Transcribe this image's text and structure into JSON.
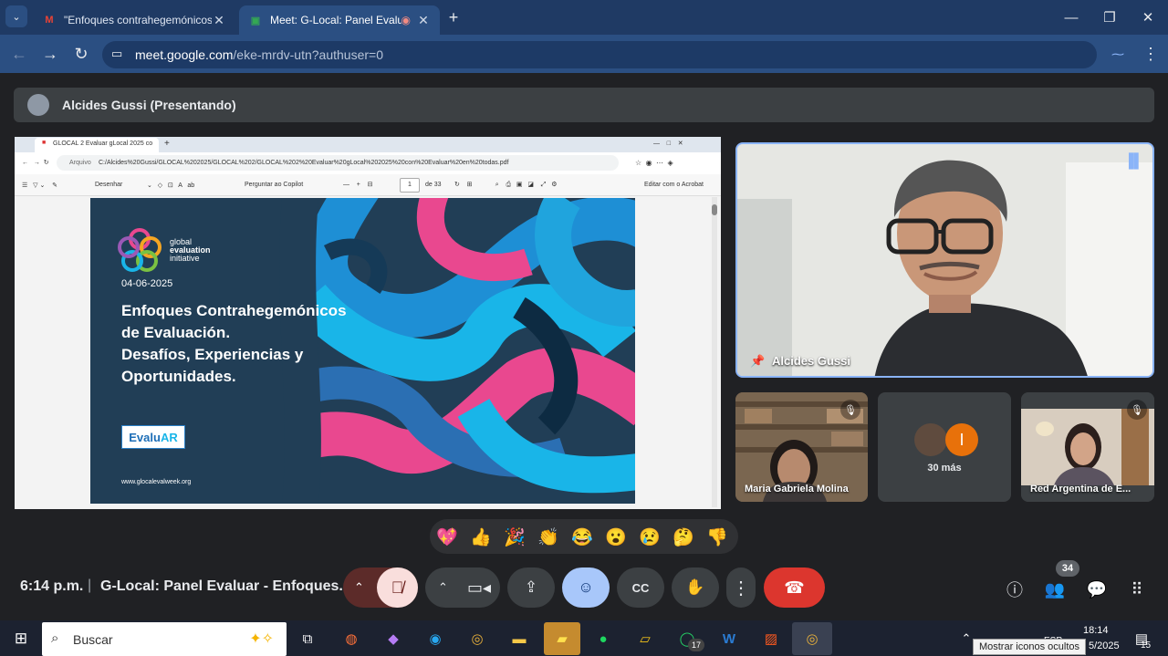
{
  "browser": {
    "tabs": [
      {
        "title": "\"Enfoques contrahegemónicos",
        "favicon": "gmail-icon"
      },
      {
        "title": "Meet: G-Local: Panel Evaluar",
        "favicon": "meet-icon"
      }
    ],
    "url_host": "meet.google.com",
    "url_path": "/eke-mrdv-utn?authuser=0"
  },
  "meet": {
    "presenter_banner": "Alcides Gussi (Presentando)",
    "shared_window": {
      "tab_title": "GLOCAL 2 Evaluar gLocal 2025 co",
      "address_prefix": "Arquivo",
      "address": "C:/Alcides%20Gussi/GLOCAL%202025/GLOCAL%202/GLOCAL%202%20Evaluar%20gLocal%202025%20con%20Evaluar%20en%20todas.pdf",
      "toolbar": {
        "draw": "Desenhar",
        "copilot": "Perguntar ao Copilot",
        "page": "1",
        "page_of": "de 33",
        "acrobat": "Editar com o Acrobat"
      },
      "slide": {
        "org_line1": "global",
        "org_line2": "evaluation",
        "org_line3": "initiative",
        "date": "04-06-2025",
        "title_lines": [
          "Enfoques Contrahegemónicos",
          "de Evaluación.",
          "Desafíos, Experiencias y",
          "Oportunidades."
        ],
        "logo_text_a": "Evalu",
        "logo_text_b": "AR",
        "url": "www.glocalevalweek.org"
      }
    },
    "main_tile_name": "Alcides Gussi",
    "tiles": [
      {
        "name": "Maria Gabriela Molina"
      },
      {
        "name": "30 más",
        "avatar_letter": "I"
      },
      {
        "name": "Red Argentina de E..."
      }
    ],
    "reactions": [
      "💖",
      "👍",
      "🎉",
      "👏",
      "😂",
      "😮",
      "😢",
      "🤔",
      "👎"
    ],
    "time": "6:14 p.m.",
    "meeting_title": "G-Local: Panel Evaluar - Enfoques...",
    "people_count": "34"
  },
  "taskbar": {
    "search_placeholder": "Buscar",
    "whatsapp_badge": "17",
    "clock_time": "18:14",
    "clock_date": "5/2025",
    "notif_count": "15",
    "tooltip": "Mostrar iconos ocultos",
    "lang": "ESP"
  },
  "colors": {
    "accent": "#8ab4f8",
    "hangup": "#ea4335",
    "mic_off": "#f9dedc"
  }
}
